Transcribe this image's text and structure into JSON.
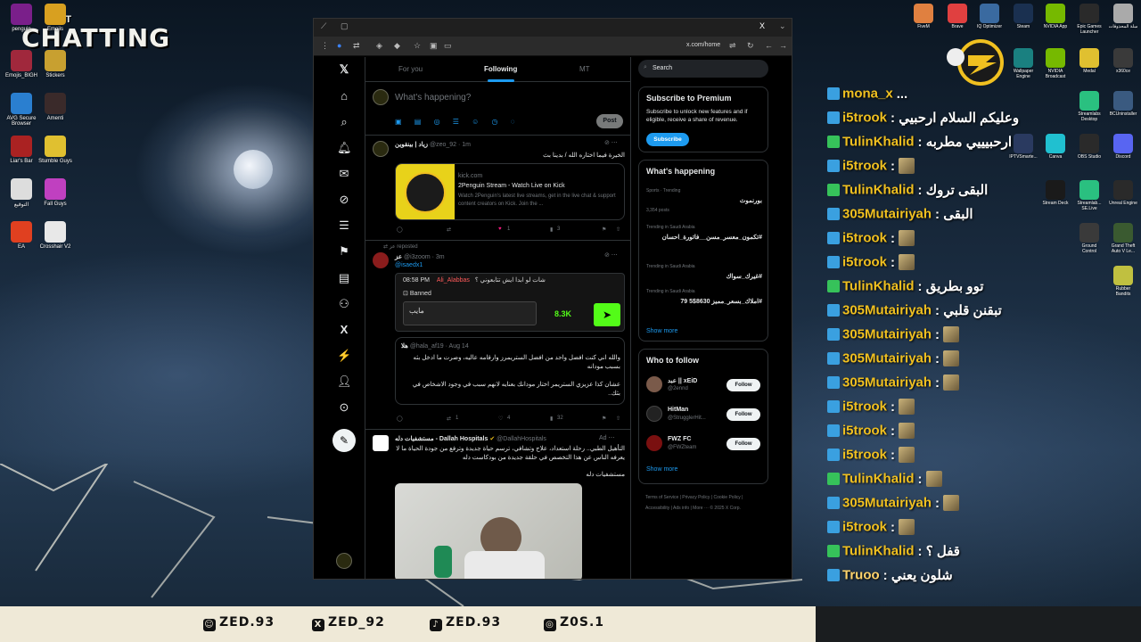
{
  "overlay": {
    "title_small": "JUST",
    "title": "CHATTING"
  },
  "desktop_icons_left": [
    {
      "label": "penguin",
      "name": "winrar-icon"
    },
    {
      "label": "Emojis",
      "name": "emojis-folder-icon"
    },
    {
      "label": "Emojis_BIGH",
      "name": "emojis-bigh-icon"
    },
    {
      "label": "Stickers",
      "name": "stickers-icon"
    },
    {
      "label": "AVG Secure Browser",
      "name": "avg-browser-icon"
    },
    {
      "label": "Amenti",
      "name": "amenti-icon"
    },
    {
      "label": "Liar's Bar",
      "name": "liars-bar-icon"
    },
    {
      "label": "Stumble Guys",
      "name": "stumble-guys-icon"
    },
    {
      "label": "التوقيع",
      "name": "document-icon"
    },
    {
      "label": "Fall Guys",
      "name": "fall-guys-icon"
    },
    {
      "label": "EA",
      "name": "ea-icon"
    },
    {
      "label": "Crosshair V2",
      "name": "crosshair-icon"
    }
  ],
  "desktop_icons_right": [
    {
      "label": "FiveM",
      "name": "fivem-icon"
    },
    {
      "label": "Brave",
      "name": "brave-icon"
    },
    {
      "label": "IQ Optimizer",
      "name": "iq-icon"
    },
    {
      "label": "Steam",
      "name": "steam-icon"
    },
    {
      "label": "NVIDIA App",
      "name": "nvidia-icon"
    },
    {
      "label": "Epic Games Launcher",
      "name": "epic-icon"
    },
    {
      "label": "سلة المحذوفات",
      "name": "recycle-bin-icon"
    },
    {
      "label": "Wallpaper Engine",
      "name": "wallpaper-engine-icon"
    },
    {
      "label": "NVIDIA Broadcast",
      "name": "nvidia-broadcast-icon"
    },
    {
      "label": "Medal",
      "name": "medal-icon"
    },
    {
      "label": "x360ce",
      "name": "x360ce-icon"
    },
    {
      "label": "Streamlabs Desktop",
      "name": "streamlabs-icon"
    },
    {
      "label": "BCUninstaller",
      "name": "bcuninstaller-icon"
    },
    {
      "label": "IPTVSmarte...",
      "name": "iptv-icon"
    },
    {
      "label": "Canva",
      "name": "canva-icon"
    },
    {
      "label": "OBS Studio",
      "name": "obs-icon"
    },
    {
      "label": "Discord",
      "name": "discord-icon"
    },
    {
      "label": "Stream Deck",
      "name": "stream-deck-icon"
    },
    {
      "label": "Streamlab... SE.Live",
      "name": "streamlabs-se-icon"
    },
    {
      "label": "Unreal Engine",
      "name": "unreal-icon"
    },
    {
      "label": "Ground Control",
      "name": "ground-control-icon"
    },
    {
      "label": "Grand Theft Auto V Le...",
      "name": "gta-icon"
    },
    {
      "label": "Rubber Bandits",
      "name": "rubber-bandits-icon"
    }
  ],
  "browser": {
    "url": "x.com/home"
  },
  "x": {
    "tabs": [
      "For you",
      "Following",
      "MT"
    ],
    "compose_placeholder": "What's happening?",
    "post_button": "Post",
    "tweets": [
      {
        "name": "زياد | بينقوين",
        "handle": "@zeo_92 · 1m",
        "text": "الخيرة فيما اختاره الله / بدينا بث",
        "card_domain": "kick.com",
        "card_title": "2Penguin Stream - Watch Live on Kick",
        "card_desc": "Watch 2Penguin's latest live streams, get in the live chat & support content creators on Kick. Join the ...",
        "likes": "1",
        "views": "3"
      },
      {
        "repost_label": "عز reposted",
        "name": "عز",
        "handle": "@i3zoom · 3m",
        "sub_handle": "@isaedx1",
        "time_chip": "08:58 PM",
        "chip_user": "Ali_Alabbas",
        "chip_msg": "شات لو ابدا ايش تتابعوني ؟",
        "banned_label": "Banned",
        "input_text": "مايب",
        "count": "8.3K",
        "quoted_name": "هلا",
        "quoted_handle": "@hala_af19 · Aug 14",
        "quoted_text_1": "والله اني كنت افضل واحد من افضل الستريمرز وارقامه عاليه، وصرت ما ادخل بثه بسبب مودانه",
        "quoted_text_2": "عشان كذا عزيزي الستريمر اختار مودانك بعنايه لانهم سبب في وجود الاشخاص في بثك..",
        "replies": "1",
        "reposts": "1",
        "likes": "4",
        "views": "32"
      },
      {
        "name": "مستشفيات دله - Dallah Hospitals",
        "handle": "@DallahHospitals",
        "ad_label": "Ad",
        "text": "التأهيل الطبي.. رحلة استعداد، علاج وتشافي، ترسم حياة جديدة وترفع من جودة الحياة ما لا يعرفه الناس عن هذا التخصص في حلقة جديدة من بودكاست دله",
        "text2": "مستشفيات دله"
      }
    ],
    "search_placeholder": "Search",
    "premium": {
      "title": "Subscribe to Premium",
      "desc": "Subscribe to unlock new features and if eligible, receive a share of revenue.",
      "button": "Subscribe"
    },
    "happening": {
      "title": "What's happening",
      "trends": [
        {
          "context": "Sports · Trending",
          "name": "بورنموث",
          "count": "3,354 posts"
        },
        {
          "context": "Trending in Saudi Arabia",
          "name": "#تكمون_معسر_مسن__فاتورة_احسان",
          "count": ""
        },
        {
          "context": "Trending in Saudi Arabia",
          "name": "#غيرك_سواك",
          "count": ""
        },
        {
          "context": "Trending in Saudi Arabia",
          "name": "#املاك_بسعر_مميز 8630$5 79",
          "count": ""
        }
      ],
      "show_more": "Show more"
    },
    "who_to_follow": {
      "title": "Who to follow",
      "users": [
        {
          "name": "عبد || xEiD",
          "handle": "@2ennd",
          "button": "Follow"
        },
        {
          "name": "HitMan",
          "handle": "@StrugglerHit...",
          "button": "Follow"
        },
        {
          "name": "FWZ FC",
          "handle": "@FWZteam",
          "button": "Follow"
        }
      ],
      "show_more": "Show more"
    },
    "footer": "Terms of Service | Privacy Policy | Cookie Policy | Accessibility | Ads info | More ··· © 2025 X Corp."
  },
  "chat": [
    {
      "user": "mona_x",
      "msg": "...",
      "color": "#f0c020",
      "emote": false
    },
    {
      "user": "i5trook",
      "msg": ": وعليكم السلام ارحبيي",
      "color": "#f0c020",
      "emote": false
    },
    {
      "user": "TulinKhalid",
      "msg": ": ارحبيييي مطربه",
      "color": "#f0c020",
      "emote": false
    },
    {
      "user": "i5trook",
      "msg": ":",
      "color": "#f0c020",
      "emote": true
    },
    {
      "user": "TulinKhalid",
      "msg": ": البقى تروك",
      "color": "#f0c020",
      "emote": false
    },
    {
      "user": "305Mutairiyah",
      "msg": ": البقى",
      "color": "#f0c020",
      "emote": false
    },
    {
      "user": "i5trook",
      "msg": ":",
      "color": "#f0c020",
      "emote": true
    },
    {
      "user": "i5trook",
      "msg": ":",
      "color": "#f0c020",
      "emote": true
    },
    {
      "user": "TulinKhalid",
      "msg": ": توو بطريق",
      "color": "#f0c020",
      "emote": false
    },
    {
      "user": "305Mutairiyah",
      "msg": ": تبقنن قلبي",
      "color": "#f0c020",
      "emote": false
    },
    {
      "user": "305Mutairiyah",
      "msg": ":",
      "color": "#f0c020",
      "emote": true
    },
    {
      "user": "305Mutairiyah",
      "msg": ":",
      "color": "#f0c020",
      "emote": true
    },
    {
      "user": "305Mutairiyah",
      "msg": ":",
      "color": "#f0c020",
      "emote": true
    },
    {
      "user": "i5trook",
      "msg": ":",
      "color": "#f0c020",
      "emote": true
    },
    {
      "user": "i5trook",
      "msg": ":",
      "color": "#f0c020",
      "emote": true
    },
    {
      "user": "i5trook",
      "msg": ":",
      "color": "#f0c020",
      "emote": true
    },
    {
      "user": "TulinKhalid",
      "msg": ":",
      "color": "#f0c020",
      "emote": true
    },
    {
      "user": "305Mutairiyah",
      "msg": ":",
      "color": "#f0c020",
      "emote": true
    },
    {
      "user": "i5trook",
      "msg": ":",
      "color": "#f0c020",
      "emote": true
    },
    {
      "user": "TulinKhalid",
      "msg": ": قفل ؟",
      "color": "#f0c020",
      "emote": false
    },
    {
      "user": "Truoo",
      "msg": ": شلون يعني",
      "color": "#ffd36b",
      "emote": false
    }
  ],
  "socials": [
    {
      "icon": "snapchat-icon",
      "glyph": "☺",
      "handle": "ZED.93"
    },
    {
      "icon": "x-icon",
      "glyph": "X",
      "handle": "ZED_92"
    },
    {
      "icon": "tiktok-icon",
      "glyph": "♪",
      "handle": "ZED.93"
    },
    {
      "icon": "instagram-icon",
      "glyph": "◎",
      "handle": "Z0S.1"
    }
  ]
}
